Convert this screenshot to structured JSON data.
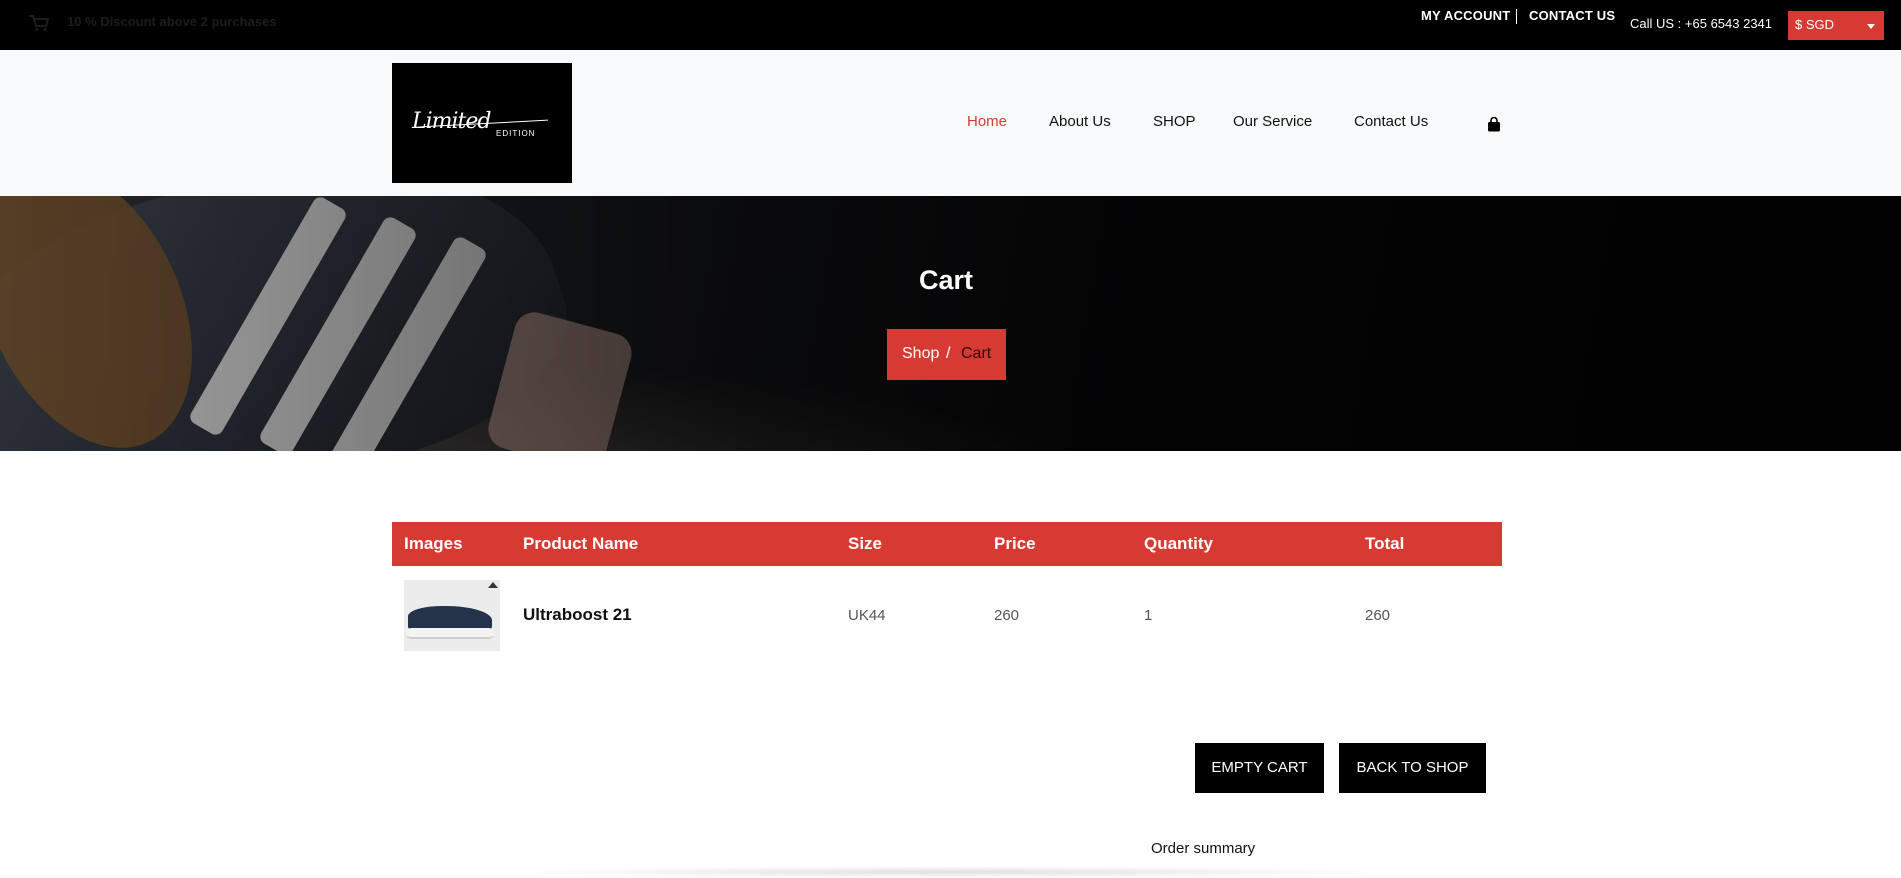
{
  "topbar": {
    "promo_text": "10 % Discount above 2 purchases",
    "my_account": "MY ACCOUNT",
    "contact_us": "CONTACT US",
    "call": "Call US : +65 6543 2341",
    "currency": "$ SGD"
  },
  "header": {
    "logo_text": "Limited",
    "logo_subtext": "EDITION",
    "nav": [
      {
        "label": "Home",
        "active": true
      },
      {
        "label": "About Us"
      },
      {
        "label": "SHOP"
      },
      {
        "label": "Our Service"
      },
      {
        "label": "Contact Us"
      }
    ],
    "cart_icon": "shopping-bag-icon"
  },
  "hero": {
    "title": "Cart",
    "breadcrumb": {
      "shop": "Shop",
      "separator": "/",
      "current": "Cart"
    }
  },
  "cart_table": {
    "headers": [
      "Images",
      "Product Name",
      "Size",
      "Price",
      "Quantity",
      "Total"
    ],
    "rows": [
      {
        "product_name": "Ultraboost 21",
        "size": "UK44",
        "price": "260",
        "quantity": "1",
        "total": "260"
      }
    ]
  },
  "actions": {
    "empty_cart": "EMPTY CART",
    "back_to_shop": "BACK TO SHOP"
  },
  "summary": {
    "title": "Order summary"
  },
  "colors": {
    "accent": "#d63a33",
    "topbar": "#000000",
    "header_bg": "#f8f9fa"
  }
}
